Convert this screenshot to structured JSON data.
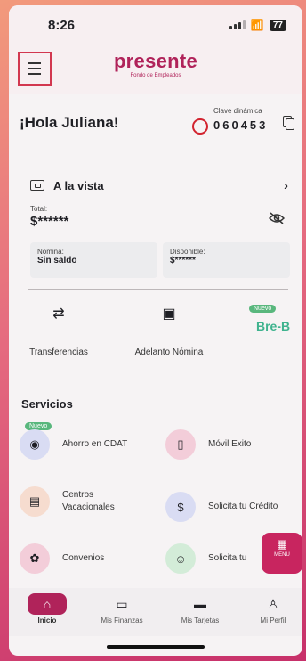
{
  "status": {
    "time": "8:26",
    "battery": "77"
  },
  "brand": {
    "name": "presente",
    "tagline": "Fondo de Empleados"
  },
  "greeting": "¡Hola Juliana!",
  "clave": {
    "label": "Clave dinámica",
    "code": "060453"
  },
  "account": {
    "name": "A la vista",
    "total_label": "Total:",
    "total_value": "$******",
    "nomina_label": "Nómina:",
    "nomina_value": "Sin saldo",
    "disponible_label": "Disponible:",
    "disponible_value": "$******"
  },
  "quick_actions": [
    {
      "label": "Transferencias",
      "icon": "transfer-icon"
    },
    {
      "label": "Adelanto Nómina",
      "icon": "payroll-advance-icon"
    },
    {
      "badge": "Nuevo",
      "label": "Bre-B",
      "icon": "breb-logo"
    }
  ],
  "services": {
    "title": "Servicios",
    "badge": "Nuevo",
    "items": [
      {
        "label": "Ahorro en CDAT",
        "icon": "cdat-icon",
        "color": "#d9dcf3"
      },
      {
        "label": "Móvil Exito",
        "icon": "mobile-phone-icon",
        "color": "#f3cdd9"
      },
      {
        "label": "Centros\nVacacionales",
        "icon": "suitcase-icon",
        "color": "#f6dccf"
      },
      {
        "label": "Solicita tu Crédito",
        "icon": "credit-hand-icon",
        "color": "#d9dcf3"
      },
      {
        "label": "Convenios",
        "icon": "lotus-icon",
        "color": "#f3cdd9"
      },
      {
        "label": "Solicita tu",
        "icon": "people-icon",
        "color": "#d3ecd8"
      }
    ]
  },
  "fab": {
    "label": "MENU"
  },
  "tabs": [
    {
      "label": "Inicio",
      "icon": "home-icon",
      "active": true
    },
    {
      "label": "Mis Finanzas",
      "icon": "wallet-icon"
    },
    {
      "label": "Mis Tarjetas",
      "icon": "card-icon"
    },
    {
      "label": "Mi Perfil",
      "icon": "user-icon"
    }
  ],
  "colors": {
    "brand": "#b0235a",
    "accent_red": "#d2232f",
    "green_badge": "#59b77d"
  }
}
